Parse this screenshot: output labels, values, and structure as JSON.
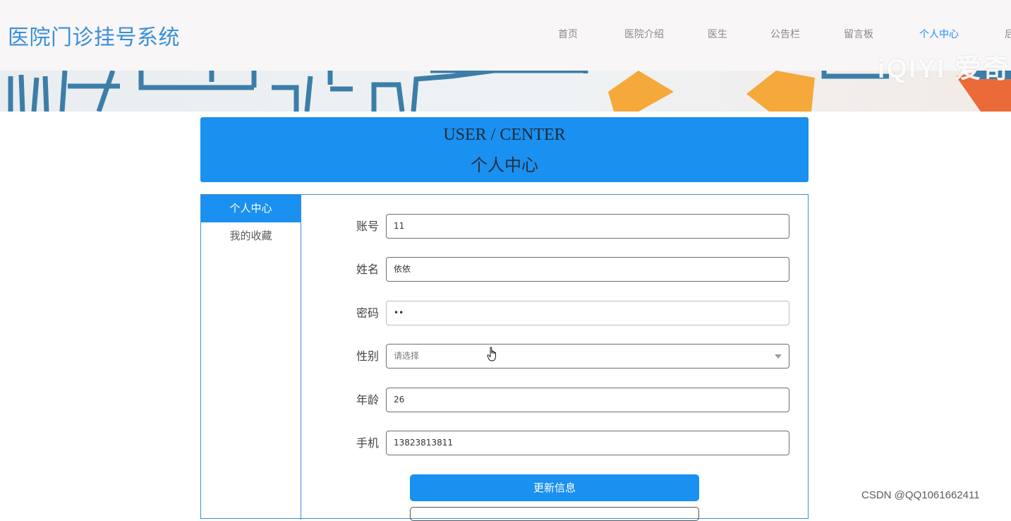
{
  "site": {
    "title": "医院门诊挂号系统"
  },
  "nav": {
    "items": [
      {
        "label": "首页"
      },
      {
        "label": "医院介绍"
      },
      {
        "label": "医生"
      },
      {
        "label": "公告栏"
      },
      {
        "label": "留言板"
      },
      {
        "label": "个人中心",
        "active": true
      },
      {
        "label": "后"
      }
    ]
  },
  "banner": {
    "watermark": "iQIYI 爱奇"
  },
  "header": {
    "title_en": "USER / CENTER",
    "title_cn": "个人中心"
  },
  "sidebar": {
    "items": [
      {
        "label": "个人中心",
        "active": true
      },
      {
        "label": "我的收藏"
      }
    ]
  },
  "form": {
    "account": {
      "label": "账号",
      "value": "11"
    },
    "name": {
      "label": "姓名",
      "value": "依依"
    },
    "password": {
      "label": "密码",
      "value": "••"
    },
    "gender": {
      "label": "性别",
      "placeholder": "请选择"
    },
    "age": {
      "label": "年龄",
      "value": "26"
    },
    "phone": {
      "label": "手机",
      "value": "13823813811"
    },
    "update_button": "更新信息"
  },
  "footer": {
    "csdn": "CSDN @QQ1061662411"
  },
  "colors": {
    "accent": "#1a90f0",
    "title": "#3a8fd8",
    "active_nav": "#1890ff"
  }
}
